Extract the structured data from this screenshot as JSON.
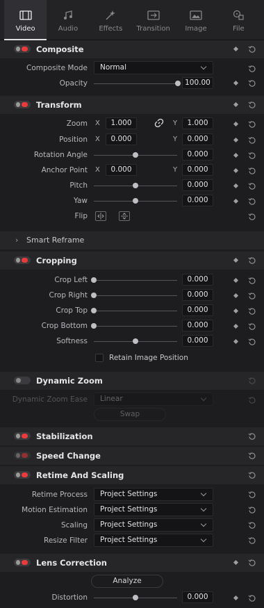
{
  "tabs": [
    {
      "label": "Video",
      "icon": "video-icon",
      "active": true
    },
    {
      "label": "Audio",
      "icon": "audio-note-icon",
      "active": false
    },
    {
      "label": "Effects",
      "icon": "effects-wand-icon",
      "active": false
    },
    {
      "label": "Transition",
      "icon": "transition-icon",
      "active": false
    },
    {
      "label": "Image",
      "icon": "image-icon",
      "active": false
    },
    {
      "label": "File",
      "icon": "file-reel-icon",
      "active": false
    }
  ],
  "composite": {
    "title": "Composite",
    "mode_label": "Composite Mode",
    "mode_value": "Normal",
    "opacity_label": "Opacity",
    "opacity_value": "100.00",
    "opacity_level": 1.0
  },
  "transform": {
    "title": "Transform",
    "zoom_label": "Zoom",
    "zoom_x": "1.000",
    "zoom_y": "1.000",
    "position_label": "Position",
    "position_x": "0.000",
    "position_y": "0.000",
    "rotation_label": "Rotation Angle",
    "rotation_value": "0.000",
    "anchor_label": "Anchor Point",
    "anchor_x": "0.000",
    "anchor_y": "0.000",
    "pitch_label": "Pitch",
    "pitch_value": "0.000",
    "yaw_label": "Yaw",
    "yaw_value": "0.000",
    "flip_label": "Flip",
    "x_axis": "X",
    "y_axis": "Y"
  },
  "smart_reframe": {
    "title": "Smart Reframe"
  },
  "cropping": {
    "title": "Cropping",
    "crop_left_label": "Crop Left",
    "crop_left": "0.000",
    "crop_right_label": "Crop Right",
    "crop_right": "0.000",
    "crop_top_label": "Crop Top",
    "crop_top": "0.000",
    "crop_bottom_label": "Crop Bottom",
    "crop_bottom": "0.000",
    "softness_label": "Softness",
    "softness": "0.000",
    "retain_label": "Retain Image Position"
  },
  "dynamic_zoom": {
    "title": "Dynamic Zoom",
    "ease_label": "Dynamic Zoom Ease",
    "ease_value": "Linear",
    "swap_label": "Swap"
  },
  "stabilization": {
    "title": "Stabilization"
  },
  "speed_change": {
    "title": "Speed Change"
  },
  "retime": {
    "title": "Retime And Scaling",
    "process_label": "Retime Process",
    "process_value": "Project Settings",
    "motion_label": "Motion Estimation",
    "motion_value": "Project Settings",
    "scaling_label": "Scaling",
    "scaling_value": "Project Settings",
    "resize_label": "Resize Filter",
    "resize_value": "Project Settings"
  },
  "lens": {
    "title": "Lens Correction",
    "analyze_label": "Analyze",
    "distortion_label": "Distortion",
    "distortion_value": "0.000"
  },
  "colors": {
    "accent": "#ea3a3a",
    "panel": "#1d1d20",
    "header": "#262629"
  }
}
